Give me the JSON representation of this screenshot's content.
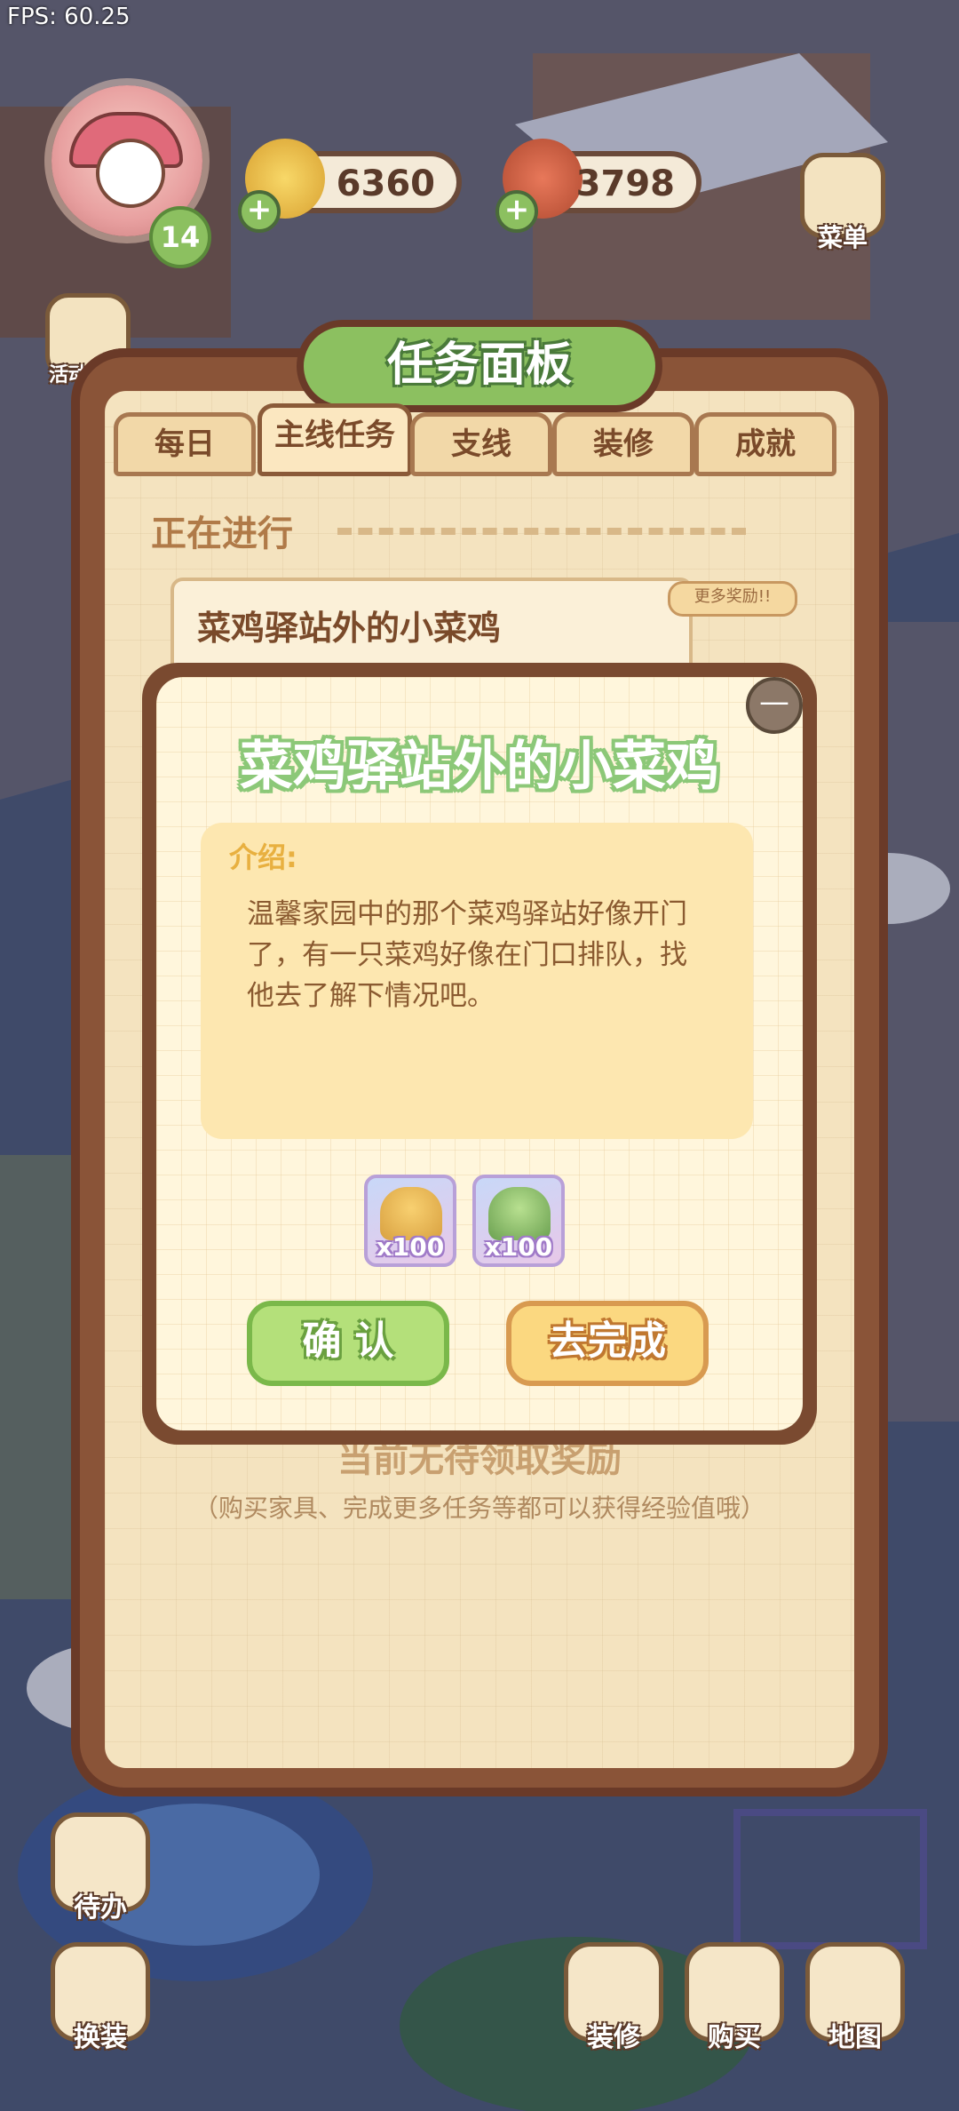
{
  "hud": {
    "fps": "FPS: 60.25",
    "level": "14",
    "coins": "6360",
    "meat": "3798",
    "menu_label": "菜单",
    "left_side": [
      "活动汇总"
    ]
  },
  "panel": {
    "title": "任务面板",
    "tabs": [
      "每日",
      "主线任务",
      "支线",
      "装修",
      "成就"
    ],
    "active_tab": 1,
    "section": "正在进行",
    "task_title": "菜鸡驿站外的小菜鸡",
    "more_reward": "更多奖励!!",
    "footer_line1": "当前无待领取奖励",
    "footer_line2": "（购买家具、完成更多任务等都可以获得经验值哦）"
  },
  "popup": {
    "close": "—",
    "title": "菜鸡驿站外的小菜鸡",
    "intro_label": "介绍:",
    "intro_text": "温馨家园中的那个菜鸡驿站好像开门了，有一只菜鸡好像在门口排队，找他去了解下情况吧。",
    "rewards": [
      {
        "icon": "gold-pile-icon",
        "qty": "x100"
      },
      {
        "icon": "green-exp-icon",
        "qty": "x100"
      }
    ],
    "confirm": "确 认",
    "go_complete": "去完成"
  },
  "bottom": {
    "todo": "待办",
    "outfit": "换装",
    "decorate": "装修",
    "shop": "购买",
    "map": "地图"
  },
  "colors": {
    "panel_brown": "#8a5438",
    "title_green": "#8cc060",
    "confirm_green": "#b4e07a",
    "go_yellow": "#fbd880"
  }
}
